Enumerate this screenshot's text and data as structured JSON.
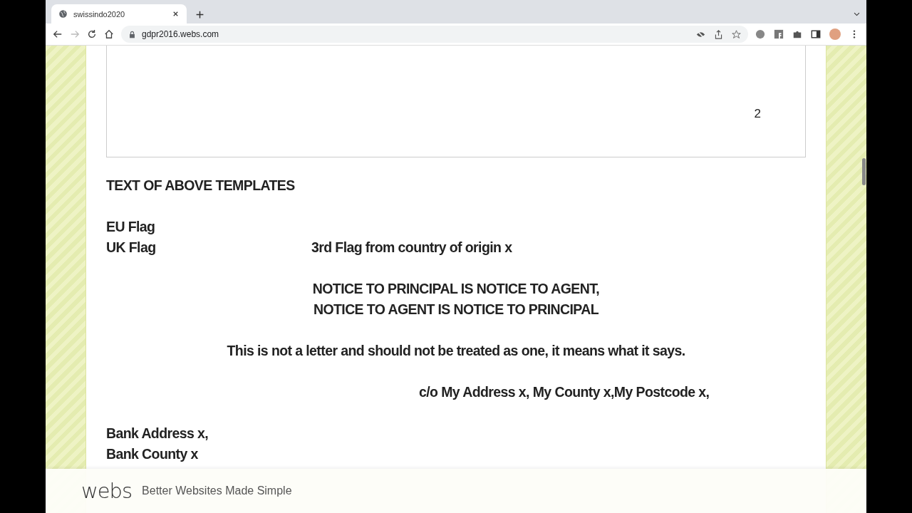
{
  "browser": {
    "tab": {
      "title": "swissindo2020",
      "selected": true
    },
    "address": "gdpr2016.webs.com"
  },
  "page": {
    "template_box": {
      "page_number": "2"
    },
    "paragraphs": [
      {
        "kind": "left",
        "lines": [
          {
            "kind": "single",
            "text": "TEXT OF ABOVE TEMPLATES"
          }
        ]
      },
      {
        "kind": "left",
        "lines": [
          {
            "kind": "single",
            "text": "EU Flag"
          },
          {
            "kind": "pair",
            "text": "UK Flag",
            "second": "3rd Flag from country of origin x"
          }
        ]
      },
      {
        "kind": "center",
        "lines": [
          {
            "kind": "single",
            "text": "NOTICE TO PRINCIPAL IS NOTICE TO AGENT,"
          },
          {
            "kind": "single",
            "text": "NOTICE TO AGENT IS NOTICE TO PRINCIPAL"
          }
        ]
      },
      {
        "kind": "center",
        "lines": [
          {
            "kind": "single",
            "text": "This is not a letter and should not be treated as one, it means what it says."
          }
        ]
      },
      {
        "kind": "indent",
        "lines": [
          {
            "kind": "single",
            "text": "c/o My Address x, My County x,My Postcode x,"
          }
        ]
      },
      {
        "kind": "left",
        "lines": [
          {
            "kind": "single",
            "text": "Bank Address x,"
          },
          {
            "kind": "single",
            "text": "Bank County x"
          }
        ]
      }
    ]
  },
  "footer": {
    "logo": "webs",
    "tagline": "Better Websites Made Simple"
  }
}
